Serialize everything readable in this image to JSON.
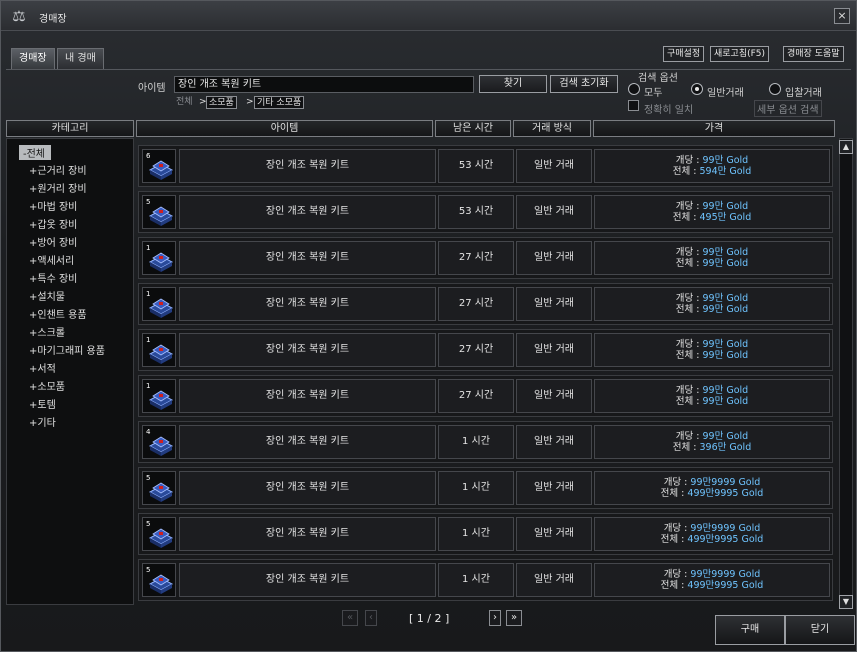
{
  "window": {
    "title": "경매장",
    "close_icon": "×"
  },
  "tabs": [
    {
      "label": "경매장",
      "active": true
    },
    {
      "label": "내 경매",
      "active": false
    }
  ],
  "top_buttons": {
    "purchase_settings": "구매설정",
    "refresh": "새로고침(F5)",
    "help": "경매장 도움말"
  },
  "search": {
    "item_label": "아이템",
    "value": "장인 개조 복원 키트",
    "find_button": "찾기",
    "reset_button": "검색 초기화",
    "breadcrumb": [
      "전체",
      "소모품",
      "기타 소모품"
    ],
    "breadcrumb_sep": ">"
  },
  "search_options": {
    "title": "검색 옵션",
    "radios": [
      {
        "label": "모두",
        "checked": false
      },
      {
        "label": "일반거래",
        "checked": true
      },
      {
        "label": "입찰거래",
        "checked": false
      }
    ],
    "exact_match": "정확히 일치",
    "detail_search": "세부 옵션 검색"
  },
  "columns": {
    "category": "카테고리",
    "item": "아이템",
    "time_left": "남은 시간",
    "trade_type": "거래 방식",
    "price": "가격"
  },
  "categories": [
    "-전체",
    "+근거리 장비",
    "+원거리 장비",
    "+마법 장비",
    "+갑옷 장비",
    "+방어 장비",
    "+액세서리",
    "+특수 장비",
    "+설치물",
    "+인챈트 용품",
    "+스크롤",
    "+마기그래피 용품",
    "+서적",
    "+소모품",
    "+토템",
    "+기타"
  ],
  "price_labels": {
    "unit": "개당 : ",
    "total": "전체 : "
  },
  "listings": [
    {
      "qty": "6",
      "name": "장인 개조 복원 키트",
      "time": "53 시간",
      "type": "일반 거래",
      "unit_price": "99만 Gold",
      "total_price": "594만 Gold"
    },
    {
      "qty": "5",
      "name": "장인 개조 복원 키트",
      "time": "53 시간",
      "type": "일반 거래",
      "unit_price": "99만 Gold",
      "total_price": "495만 Gold"
    },
    {
      "qty": "1",
      "name": "장인 개조 복원 키트",
      "time": "27 시간",
      "type": "일반 거래",
      "unit_price": "99만 Gold",
      "total_price": "99만 Gold"
    },
    {
      "qty": "1",
      "name": "장인 개조 복원 키트",
      "time": "27 시간",
      "type": "일반 거래",
      "unit_price": "99만 Gold",
      "total_price": "99만 Gold"
    },
    {
      "qty": "1",
      "name": "장인 개조 복원 키트",
      "time": "27 시간",
      "type": "일반 거래",
      "unit_price": "99만 Gold",
      "total_price": "99만 Gold"
    },
    {
      "qty": "1",
      "name": "장인 개조 복원 키트",
      "time": "27 시간",
      "type": "일반 거래",
      "unit_price": "99만 Gold",
      "total_price": "99만 Gold"
    },
    {
      "qty": "4",
      "name": "장인 개조 복원 키트",
      "time": "1 시간",
      "type": "일반 거래",
      "unit_price": "99만 Gold",
      "total_price": "396만 Gold"
    },
    {
      "qty": "5",
      "name": "장인 개조 복원 키트",
      "time": "1 시간",
      "type": "일반 거래",
      "unit_price": "99만9999 Gold",
      "total_price": "499만9995 Gold"
    },
    {
      "qty": "5",
      "name": "장인 개조 복원 키트",
      "time": "1 시간",
      "type": "일반 거래",
      "unit_price": "99만9999 Gold",
      "total_price": "499만9995 Gold"
    },
    {
      "qty": "5",
      "name": "장인 개조 복원 키트",
      "time": "1 시간",
      "type": "일반 거래",
      "unit_price": "99만9999 Gold",
      "total_price": "499만9995 Gold"
    }
  ],
  "pager": {
    "text": "[ 1 / 2 ]",
    "first": "«",
    "prev": "‹",
    "next": "›",
    "last": "»"
  },
  "bottom_buttons": {
    "buy": "구매",
    "close": "닫기"
  },
  "colors": {
    "gold_text": "#6fc4ff",
    "background": "#1c1e21"
  }
}
